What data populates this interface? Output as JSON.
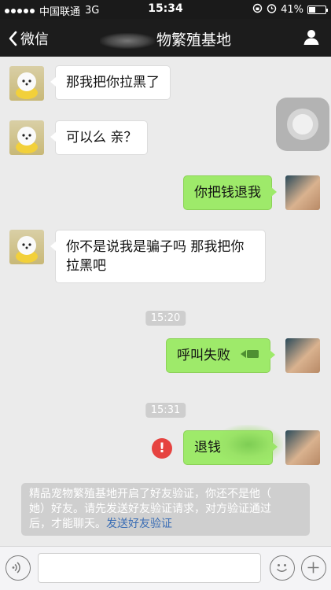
{
  "status_bar": {
    "carrier": "中国联通",
    "network": "3G",
    "time": "15:34",
    "battery_text": "41%",
    "battery_level": 0.41
  },
  "nav": {
    "back_label": "微信",
    "title": "物繁殖基地",
    "contact_icon": "person-icon"
  },
  "messages": [
    {
      "side": "in",
      "text": "那我把你拉黑了"
    },
    {
      "side": "in",
      "text": "可以么 亲？"
    },
    {
      "side": "out",
      "text": "你把钱退我"
    },
    {
      "side": "in",
      "lines": [
        "你不是说我是骗子吗 那我把你",
        "拉黑吧"
      ]
    },
    {
      "side": "out",
      "text": "呼叫失败",
      "icon": "video-call-icon"
    },
    {
      "side": "out",
      "text": "退钱",
      "status": "failed"
    }
  ],
  "timestamps": [
    "15:20",
    "15:31"
  ],
  "error_glyph": "!",
  "system_notice": {
    "lines": [
      "精品宠物繁殖基地开启了好友验证，你还不是他（",
      "她）好友。请先发送好友验证请求，对方验证通过",
      "后，才能聊天。"
    ],
    "link": "发送好友验证"
  },
  "input_bar": {
    "voice_icon": "voice-icon",
    "emoji_icon": "emoji-icon",
    "plus_icon": "plus-icon"
  },
  "colors": {
    "out_bubble": "#9eea6a",
    "in_bubble": "#ffffff",
    "link": "#3b6eb5",
    "error": "#e64340"
  }
}
